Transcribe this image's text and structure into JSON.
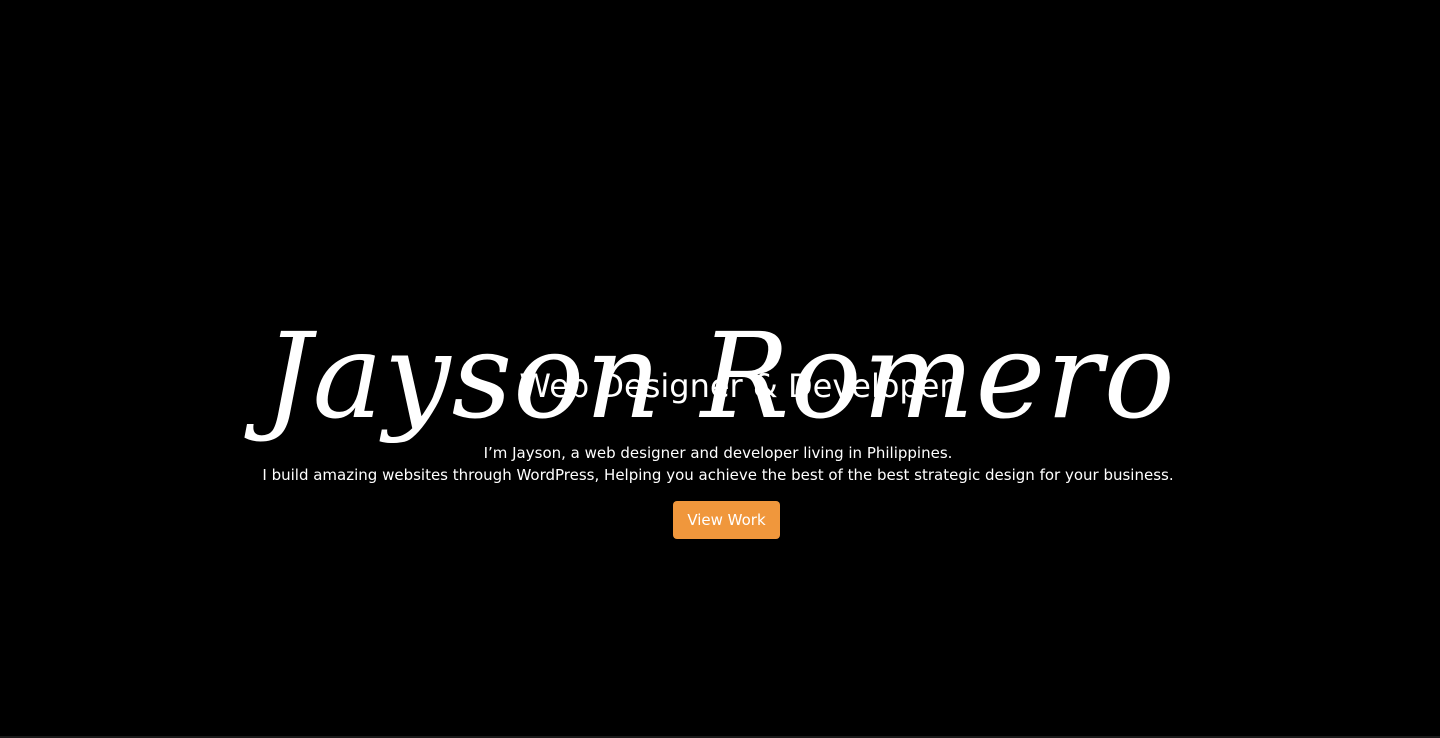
{
  "hero": {
    "name": "Jayson Romero",
    "subtitle": "Web Designer & Developer",
    "intro_line_1": "I’m Jayson, a web designer and developer living in Philippines.",
    "intro_line_2": "I build amazing websites through WordPress, Helping you achieve the best of the best strategic design for your business.",
    "cta_label": "View Work"
  },
  "colors": {
    "background": "#000000",
    "text": "#ffffff",
    "accent": "#f0973c"
  }
}
